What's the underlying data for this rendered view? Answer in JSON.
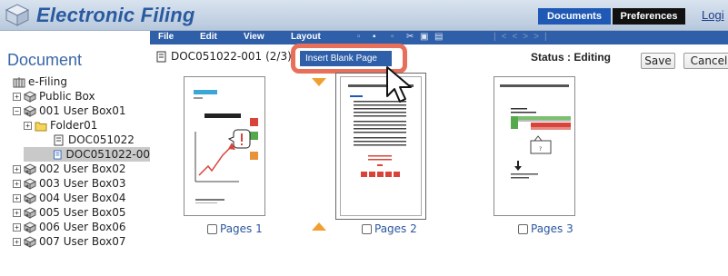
{
  "header": {
    "app_title": "Electronic Filing",
    "tab_documents": "Documents",
    "tab_preferences": "Preferences",
    "login": "Logi"
  },
  "menubar": {
    "items": [
      "File",
      "Edit",
      "View",
      "Layout"
    ]
  },
  "sidebar": {
    "title": "Document",
    "tree": [
      {
        "label": "e-Filing",
        "icon": "efiling-icon"
      },
      {
        "label": "Public Box",
        "icon": "box-icon"
      },
      {
        "label": "001 User Box01",
        "icon": "user-box-icon"
      },
      {
        "label": "Folder01",
        "icon": "folder-icon"
      },
      {
        "label": "DOC051022",
        "icon": "document-icon"
      },
      {
        "label": "DOC051022-00",
        "icon": "document-icon"
      },
      {
        "label": "002 User Box02",
        "icon": "user-box-icon"
      },
      {
        "label": "003 User Box03",
        "icon": "user-box-icon"
      },
      {
        "label": "004 User Box04",
        "icon": "user-box-icon"
      },
      {
        "label": "005 User Box05",
        "icon": "user-box-icon"
      },
      {
        "label": "006 User Box06",
        "icon": "user-box-icon"
      },
      {
        "label": "007 User Box07",
        "icon": "user-box-icon"
      }
    ]
  },
  "document": {
    "name": "DOC051022-001",
    "page_info": "(2/3)",
    "status": "Status : Editing",
    "save_label": "Save",
    "cancel_label": "Cancel",
    "insert_blank_page": "Insert Blank Page",
    "pages": [
      {
        "label": "Pages 1"
      },
      {
        "label": "Pages 2"
      },
      {
        "label": "Pages 3"
      }
    ]
  },
  "colors": {
    "accent": "#2e5fa8",
    "highlight": "#e8705a",
    "arrow": "#f0a030"
  }
}
